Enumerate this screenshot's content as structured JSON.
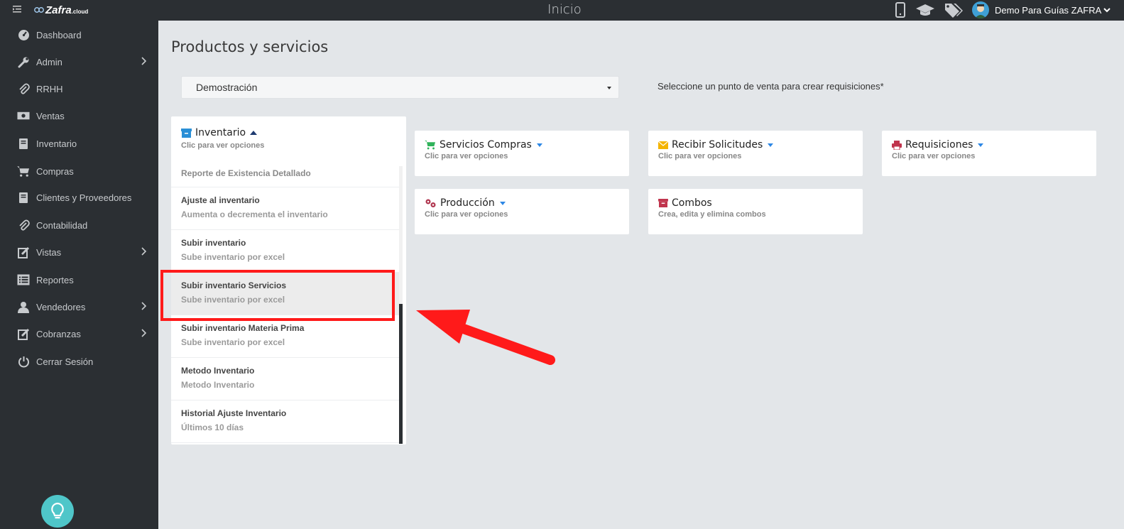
{
  "app": {
    "logo_name": "Zafra",
    "logo_tld": ".cloud",
    "header_title": "Inicio",
    "user_name": "Demo Para Guías ZAFRA"
  },
  "sidebar": {
    "items": [
      {
        "label": "Dashboard",
        "icon": "dashboard-icon"
      },
      {
        "label": "Admin",
        "icon": "wrench-icon",
        "has_submenu": true
      },
      {
        "label": "RRHH",
        "icon": "paperclip-icon"
      },
      {
        "label": "Ventas",
        "icon": "money-icon"
      },
      {
        "label": "Inventario",
        "icon": "book-icon"
      },
      {
        "label": "Compras",
        "icon": "cart-icon"
      },
      {
        "label": "Clientes y Proveedores",
        "icon": "book-icon"
      },
      {
        "label": "Contabilidad",
        "icon": "paperclip-icon"
      },
      {
        "label": "Vistas",
        "icon": "edit-icon",
        "has_submenu": true
      },
      {
        "label": "Reportes",
        "icon": "list-icon"
      },
      {
        "label": "Vendedores",
        "icon": "user-icon",
        "has_submenu": true
      },
      {
        "label": "Cobranzas",
        "icon": "edit-icon",
        "has_submenu": true
      },
      {
        "label": "Cerrar Sesión",
        "icon": "power-icon"
      }
    ]
  },
  "main": {
    "title": "Productos y servicios",
    "point_of_sale_select": "Demostración",
    "hint": "Seleccione un punto de venta para crear requisiciones*",
    "inventario": {
      "title": "Inventario",
      "subtitle": "Clic para ver opciones",
      "items": [
        {
          "title": "Reporte de Existencia Detallado",
          "subtitle": ""
        },
        {
          "title": "Ajuste al inventario",
          "subtitle": "Aumenta o decrementa el inventario"
        },
        {
          "title": "Subir inventario",
          "subtitle": "Sube inventario por excel"
        },
        {
          "title": "Subir inventario Servicios",
          "subtitle": "Sube inventario por excel"
        },
        {
          "title": "Subir inventario Materia Prima",
          "subtitle": "Sube inventario por excel"
        },
        {
          "title": "Metodo Inventario",
          "subtitle": "Metodo Inventario"
        },
        {
          "title": "Historial Ajuste Inventario",
          "subtitle": "Últimos 10 días"
        }
      ]
    },
    "cards": [
      {
        "title": "Servicios Compras",
        "subtitle": "Clic para ver opciones",
        "icon": "cart-icon"
      },
      {
        "title": "Recibir Solicitudes",
        "subtitle": "Clic para ver opciones",
        "icon": "envelope-icon"
      },
      {
        "title": "Requisiciones",
        "subtitle": "Clic para ver opciones",
        "icon": "printer-icon"
      },
      {
        "title": "Producción",
        "subtitle": "Clic para ver opciones",
        "icon": "gears-icon"
      },
      {
        "title": "Combos",
        "subtitle": "Crea, edita y elimina combos",
        "icon": "archive-icon"
      }
    ]
  },
  "colors": {
    "sidebar_bg": "#2b2f33",
    "content_bg": "#e3e6e9",
    "highlight": "#ff1a1a",
    "accent_blue": "#2d87e5",
    "help_bubble": "#4fc6c9"
  }
}
